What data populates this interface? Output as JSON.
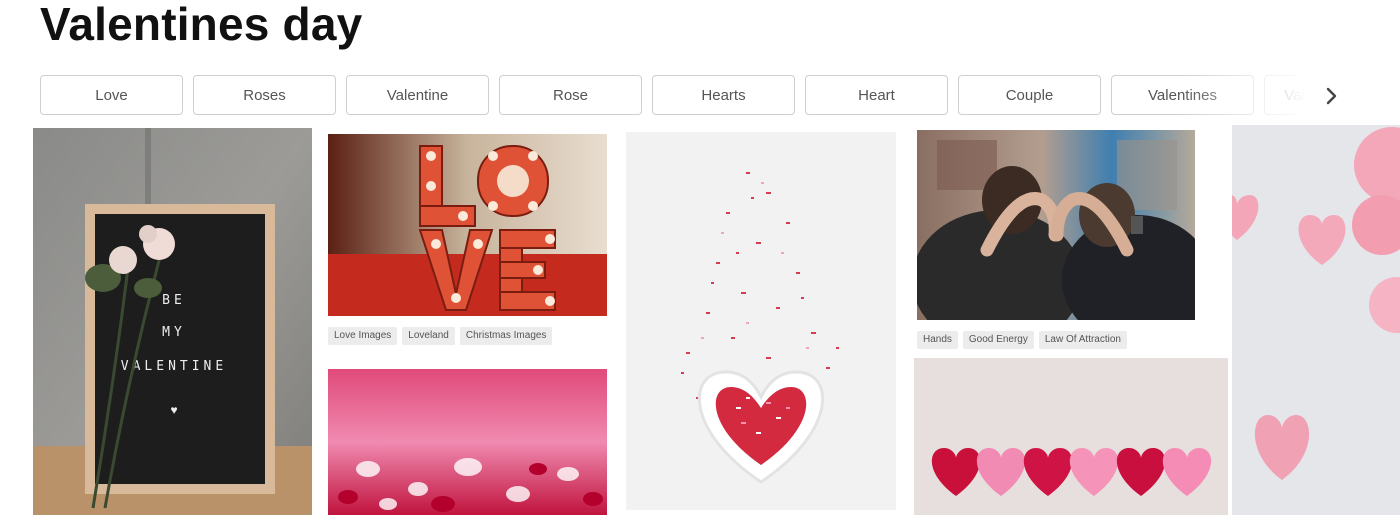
{
  "page": {
    "title": "Valentines day"
  },
  "related_tags": [
    "Love",
    "Roses",
    "Valentine",
    "Rose",
    "Hearts",
    "Heart",
    "Couple",
    "Valentines",
    "Valentine's Day"
  ],
  "next_icon": "chevron-right-icon",
  "photos": {
    "letter_board": {
      "letters": [
        "BE",
        "MY",
        "VALENTINE"
      ],
      "heart": "♥"
    },
    "love_sign": {
      "letters": [
        "L",
        "O",
        "V",
        "E"
      ],
      "chips": [
        "Love Images",
        "Loveland",
        "Christmas Images"
      ]
    },
    "couple_hands": {
      "chips": [
        "Hands",
        "Good Energy",
        "Law Of Attraction"
      ]
    }
  },
  "colors": {
    "accent_red": "#d9232f",
    "pink": "#f39ab9",
    "text": "#111111"
  }
}
